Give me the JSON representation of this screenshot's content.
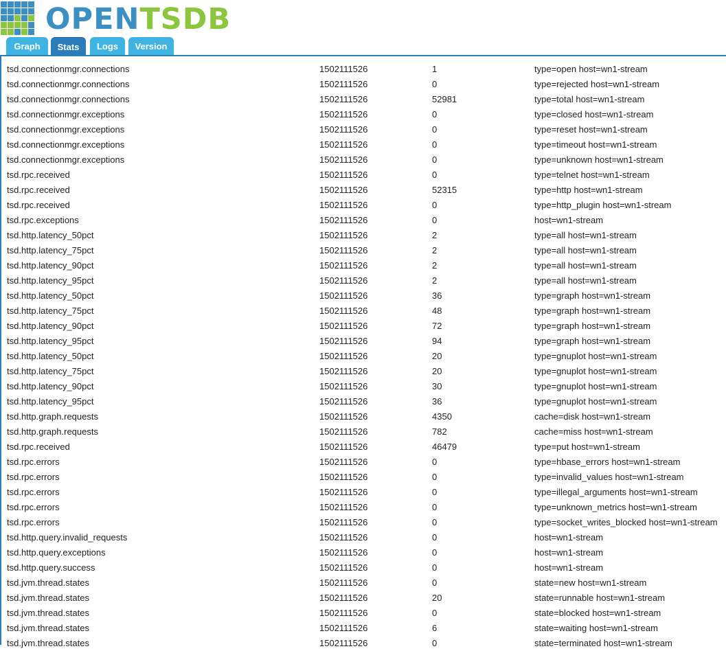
{
  "brand": {
    "name_part1": "OPEN",
    "name_part2": "TSDB",
    "colors": {
      "blue": "#3c8fc2",
      "green": "#8cc63f"
    }
  },
  "tabs": [
    {
      "label": "Graph",
      "active": false
    },
    {
      "label": "Stats",
      "active": true
    },
    {
      "label": "Logs",
      "active": false
    },
    {
      "label": "Version",
      "active": false
    }
  ],
  "colors": {
    "tab": "#3fb3e2",
    "tab_active": "#2a7cba",
    "bar": "#2a7cba"
  },
  "stats": [
    [
      "tsd.connectionmgr.connections",
      "1502111526",
      "1",
      "type=open host=wn1-stream"
    ],
    [
      "tsd.connectionmgr.connections",
      "1502111526",
      "0",
      "type=rejected host=wn1-stream"
    ],
    [
      "tsd.connectionmgr.connections",
      "1502111526",
      "52981",
      "type=total host=wn1-stream"
    ],
    [
      "tsd.connectionmgr.exceptions",
      "1502111526",
      "0",
      "type=closed host=wn1-stream"
    ],
    [
      "tsd.connectionmgr.exceptions",
      "1502111526",
      "0",
      "type=reset host=wn1-stream"
    ],
    [
      "tsd.connectionmgr.exceptions",
      "1502111526",
      "0",
      "type=timeout host=wn1-stream"
    ],
    [
      "tsd.connectionmgr.exceptions",
      "1502111526",
      "0",
      "type=unknown host=wn1-stream"
    ],
    [
      "tsd.rpc.received",
      "1502111526",
      "0",
      "type=telnet host=wn1-stream"
    ],
    [
      "tsd.rpc.received",
      "1502111526",
      "52315",
      "type=http host=wn1-stream"
    ],
    [
      "tsd.rpc.received",
      "1502111526",
      "0",
      "type=http_plugin host=wn1-stream"
    ],
    [
      "tsd.rpc.exceptions",
      "1502111526",
      "0",
      "host=wn1-stream"
    ],
    [
      "tsd.http.latency_50pct",
      "1502111526",
      "2",
      "type=all host=wn1-stream"
    ],
    [
      "tsd.http.latency_75pct",
      "1502111526",
      "2",
      "type=all host=wn1-stream"
    ],
    [
      "tsd.http.latency_90pct",
      "1502111526",
      "2",
      "type=all host=wn1-stream"
    ],
    [
      "tsd.http.latency_95pct",
      "1502111526",
      "2",
      "type=all host=wn1-stream"
    ],
    [
      "tsd.http.latency_50pct",
      "1502111526",
      "36",
      "type=graph host=wn1-stream"
    ],
    [
      "tsd.http.latency_75pct",
      "1502111526",
      "48",
      "type=graph host=wn1-stream"
    ],
    [
      "tsd.http.latency_90pct",
      "1502111526",
      "72",
      "type=graph host=wn1-stream"
    ],
    [
      "tsd.http.latency_95pct",
      "1502111526",
      "94",
      "type=graph host=wn1-stream"
    ],
    [
      "tsd.http.latency_50pct",
      "1502111526",
      "20",
      "type=gnuplot host=wn1-stream"
    ],
    [
      "tsd.http.latency_75pct",
      "1502111526",
      "20",
      "type=gnuplot host=wn1-stream"
    ],
    [
      "tsd.http.latency_90pct",
      "1502111526",
      "30",
      "type=gnuplot host=wn1-stream"
    ],
    [
      "tsd.http.latency_95pct",
      "1502111526",
      "36",
      "type=gnuplot host=wn1-stream"
    ],
    [
      "tsd.http.graph.requests",
      "1502111526",
      "4350",
      "cache=disk host=wn1-stream"
    ],
    [
      "tsd.http.graph.requests",
      "1502111526",
      "782",
      "cache=miss host=wn1-stream"
    ],
    [
      "tsd.rpc.received",
      "1502111526",
      "46479",
      "type=put host=wn1-stream"
    ],
    [
      "tsd.rpc.errors",
      "1502111526",
      "0",
      "type=hbase_errors host=wn1-stream"
    ],
    [
      "tsd.rpc.errors",
      "1502111526",
      "0",
      "type=invalid_values host=wn1-stream"
    ],
    [
      "tsd.rpc.errors",
      "1502111526",
      "0",
      "type=illegal_arguments host=wn1-stream"
    ],
    [
      "tsd.rpc.errors",
      "1502111526",
      "0",
      "type=unknown_metrics host=wn1-stream"
    ],
    [
      "tsd.rpc.errors",
      "1502111526",
      "0",
      "type=socket_writes_blocked host=wn1-stream"
    ],
    [
      "tsd.http.query.invalid_requests",
      "1502111526",
      "0",
      "host=wn1-stream"
    ],
    [
      "tsd.http.query.exceptions",
      "1502111526",
      "0",
      "host=wn1-stream"
    ],
    [
      "tsd.http.query.success",
      "1502111526",
      "0",
      "host=wn1-stream"
    ],
    [
      "tsd.jvm.thread.states",
      "1502111526",
      "0",
      "state=new host=wn1-stream"
    ],
    [
      "tsd.jvm.thread.states",
      "1502111526",
      "20",
      "state=runnable host=wn1-stream"
    ],
    [
      "tsd.jvm.thread.states",
      "1502111526",
      "0",
      "state=blocked host=wn1-stream"
    ],
    [
      "tsd.jvm.thread.states",
      "1502111526",
      "6",
      "state=waiting host=wn1-stream"
    ],
    [
      "tsd.jvm.thread.states",
      "1502111526",
      "0",
      "state=terminated host=wn1-stream"
    ]
  ]
}
